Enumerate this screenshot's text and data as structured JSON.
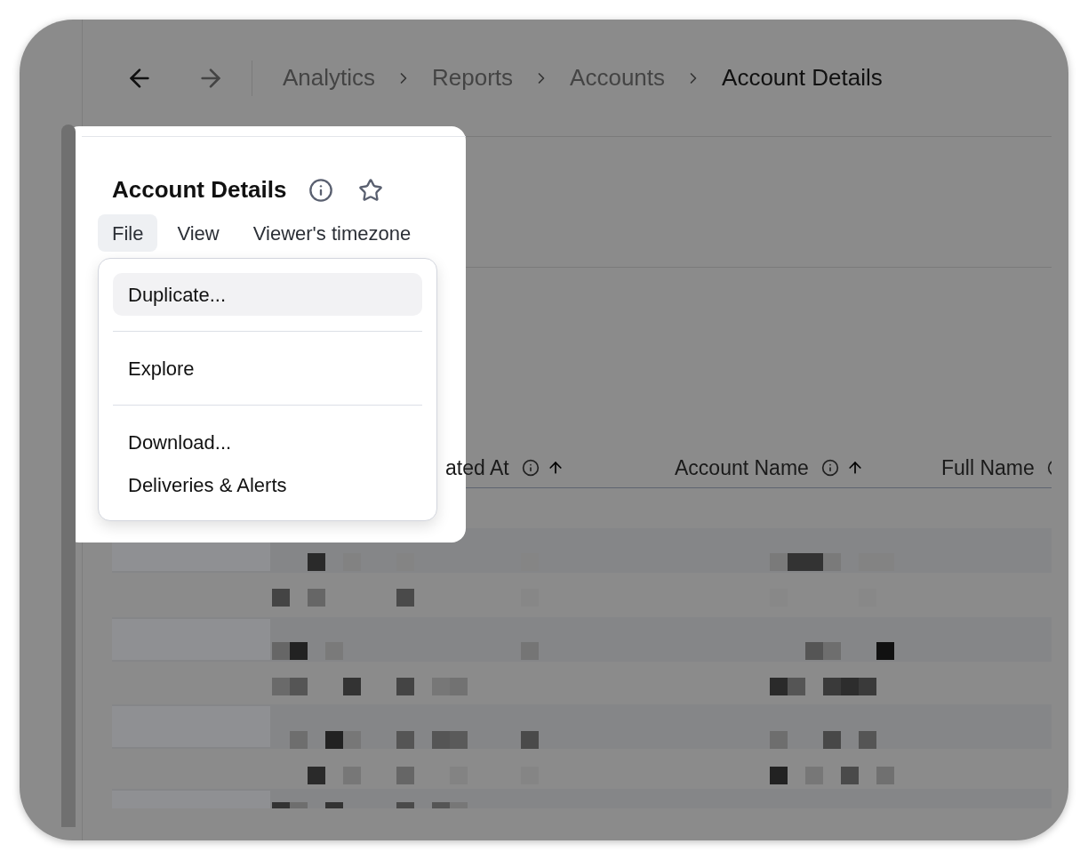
{
  "nav": {
    "breadcrumb": [
      {
        "label": "Analytics",
        "current": false
      },
      {
        "label": "Reports",
        "current": false
      },
      {
        "label": "Accounts",
        "current": false
      },
      {
        "label": "Account Details",
        "current": true
      }
    ]
  },
  "header": {
    "title": "Account Details",
    "starred": false
  },
  "menu_bar": [
    {
      "label": "File",
      "selected": true
    },
    {
      "label": "View",
      "selected": false
    },
    {
      "label": "Viewer's timezone",
      "selected": false
    }
  ],
  "file_menu": {
    "groups": [
      [
        {
          "label": "Duplicate...",
          "selected": true
        }
      ],
      [
        {
          "label": "Explore",
          "selected": false
        }
      ],
      [
        {
          "label": "Download...",
          "selected": false
        },
        {
          "label": "Deliveries & Alerts",
          "selected": false
        }
      ]
    ]
  },
  "table": {
    "columns": [
      {
        "label": "ated At",
        "info": true,
        "sorted_ascending": true
      },
      {
        "label": "Account Name",
        "info": true,
        "sorted_ascending": true
      },
      {
        "label": "Full Name",
        "info": true,
        "sorted_ascending": false
      }
    ]
  }
}
